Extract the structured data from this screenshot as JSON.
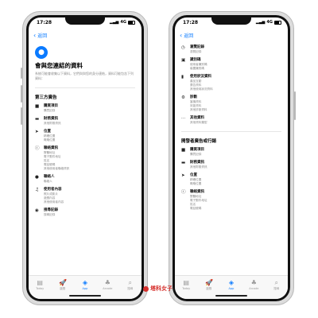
{
  "status": {
    "time": "17:28",
    "network": "4G"
  },
  "nav": {
    "back_label": "返回"
  },
  "left": {
    "title": "會與您連結的資料",
    "description": "系統可能會收集以下資料，它們與與您的身分連結，資料可能包含下列資料：",
    "section": "第三方廣告",
    "items": [
      {
        "icon": "■",
        "label": "購買項目",
        "subs": [
          "購買記錄"
        ]
      },
      {
        "icon": "▬",
        "label": "財務資訊",
        "subs": [
          "其他財務資訊"
        ]
      },
      {
        "icon": "➤",
        "label": "位置",
        "subs": [
          "精確位置",
          "概略位置"
        ]
      },
      {
        "icon": "ⓘ",
        "label": "聯絡資訊",
        "subs": [
          "實體地址",
          "電子郵件地址",
          "姓名",
          "電話號碼",
          "其他使用者聯絡資訊"
        ]
      },
      {
        "icon": "●",
        "label": "聯絡人",
        "subs": [
          "聯絡人"
        ]
      },
      {
        "icon": "♫",
        "label": "使用者內容",
        "subs": [
          "照片或影片",
          "遊戲內容",
          "其他使用者內容"
        ]
      },
      {
        "icon": "◉",
        "label": "搜尋記錄",
        "subs": [
          "搜尋記錄"
        ]
      }
    ]
  },
  "right": {
    "items_top": [
      {
        "icon": "◷",
        "label": "瀏覽記錄",
        "subs": [
          "瀏覽記錄"
        ]
      },
      {
        "icon": "▣",
        "label": "識別碼",
        "subs": [
          "使用者識別碼",
          "裝置識別碼"
        ]
      },
      {
        "icon": "▮",
        "label": "使用狀況資料",
        "subs": [
          "產品互動",
          "廣告資料",
          "其他使用狀況資料"
        ]
      },
      {
        "icon": "⚙",
        "label": "診斷",
        "subs": [
          "當機資料",
          "效能資料",
          "其他診斷資料"
        ]
      },
      {
        "icon": "⋯",
        "label": "其他資料",
        "subs": [
          "其他資料類型"
        ]
      }
    ],
    "section": "開發者廣告或行銷",
    "items_bottom": [
      {
        "icon": "■",
        "label": "購買項目",
        "subs": [
          "購買記錄"
        ]
      },
      {
        "icon": "▬",
        "label": "財務資訊",
        "subs": [
          "其他財務資訊"
        ]
      },
      {
        "icon": "➤",
        "label": "位置",
        "subs": [
          "精確位置",
          "概略位置"
        ]
      },
      {
        "icon": "ⓘ",
        "label": "聯絡資訊",
        "subs": [
          "實體地址",
          "電子郵件地址",
          "姓名",
          "電話號碼"
        ]
      }
    ]
  },
  "tabs": [
    {
      "icon": "▤",
      "label": "Today",
      "icon_name": "today-icon"
    },
    {
      "icon": "🚀",
      "label": "遊戲",
      "icon_name": "games-icon"
    },
    {
      "icon": "◈",
      "label": "App",
      "icon_name": "apps-icon",
      "active": true
    },
    {
      "icon": "♣",
      "label": "Arcade",
      "icon_name": "arcade-icon"
    },
    {
      "icon": "⌕",
      "label": "搜尋",
      "icon_name": "search-icon"
    }
  ],
  "watermark": "塔科女子"
}
